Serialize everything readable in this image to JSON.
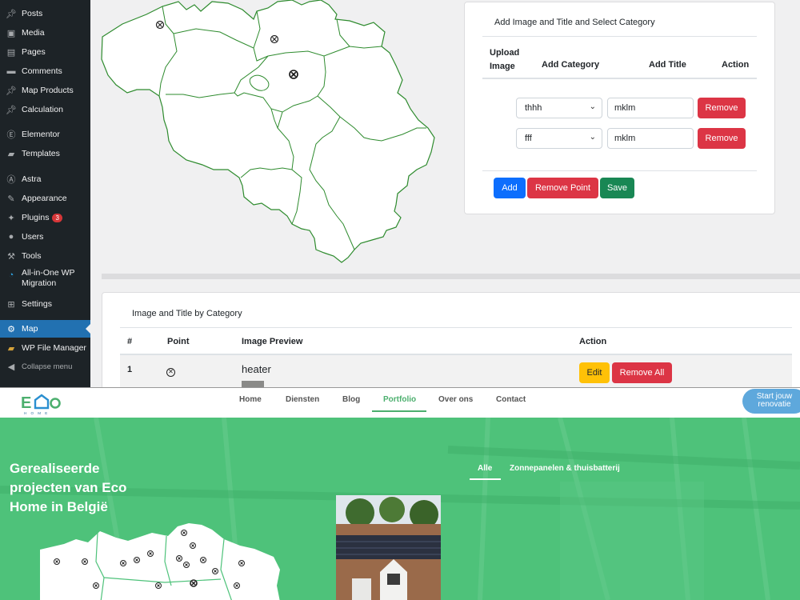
{
  "sidebar": {
    "items": [
      {
        "label": "Posts",
        "icon": "pin-icon"
      },
      {
        "label": "Media",
        "icon": "media-icon"
      },
      {
        "label": "Pages",
        "icon": "page-icon"
      },
      {
        "label": "Comments",
        "icon": "comment-icon"
      },
      {
        "label": "Map Products",
        "icon": "pin-icon"
      },
      {
        "label": "Calculation",
        "icon": "pin-icon"
      },
      {
        "label": "Elementor",
        "icon": "elementor-icon"
      },
      {
        "label": "Templates",
        "icon": "folder-icon"
      },
      {
        "label": "Astra",
        "icon": "astra-icon"
      },
      {
        "label": "Appearance",
        "icon": "brush-icon"
      },
      {
        "label": "Plugins",
        "icon": "plug-icon",
        "badge": "3"
      },
      {
        "label": "Users",
        "icon": "user-icon"
      },
      {
        "label": "Tools",
        "icon": "wrench-icon"
      },
      {
        "label": "All-in-One WP Migration",
        "icon": "migration-icon"
      },
      {
        "label": "Settings",
        "icon": "settings-icon"
      },
      {
        "label": "Map",
        "icon": "gear-icon",
        "active": true
      },
      {
        "label": "WP File Manager",
        "icon": "folder-icon"
      },
      {
        "label": "Collapse menu",
        "icon": "collapse-icon"
      }
    ]
  },
  "form_card": {
    "title": "Add Image and Title and Select Category",
    "headers": {
      "upload": "Upload Image",
      "category": "Add Category",
      "title": "Add Title",
      "action": "Action"
    },
    "rows": [
      {
        "category": "thhh",
        "title": "mklm",
        "remove": "Remove"
      },
      {
        "category": "fff",
        "title": "mklm",
        "remove": "Remove"
      }
    ],
    "buttons": {
      "add": "Add",
      "remove_point": "Remove Point",
      "save": "Save"
    }
  },
  "table_card": {
    "title": "Image and Title by Category",
    "headers": [
      "#",
      "Point",
      "Image Preview",
      "Action"
    ],
    "row": {
      "index": "1",
      "title": "heater",
      "edit": "Edit",
      "remove_all": "Remove All"
    }
  },
  "site": {
    "nav": [
      "Home",
      "Diensten",
      "Blog",
      "Portfolio",
      "Over ons",
      "Contact"
    ],
    "active_nav": "Portfolio",
    "cta": "Start jouw renovatie",
    "hero_title": "Gerealiseerde projecten van Eco Home in België",
    "filters": [
      "Alle",
      "Zonnepanelen & thuisbatterij"
    ],
    "logo_sub": "H O M E",
    "colors": {
      "accent": "#4caf6e",
      "hero": "#4ec27a",
      "cta": "#5ea8dc"
    }
  }
}
